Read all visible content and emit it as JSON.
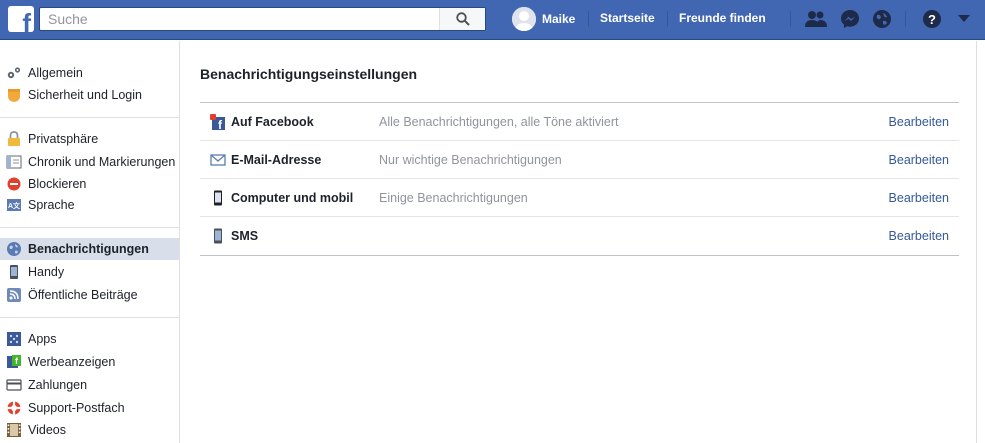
{
  "topbar": {
    "search_placeholder": "Suche",
    "user_name": "Maike",
    "home_label": "Startseite",
    "find_friends_label": "Freunde finden",
    "icons": [
      "friend-requests-icon",
      "messenger-icon",
      "notifications-globe-icon",
      "help-icon",
      "menu-arrow-icon"
    ]
  },
  "sidebar": {
    "items": [
      {
        "label": "Allgemein",
        "icon": "gears-icon"
      },
      {
        "label": "Sicherheit und Login",
        "icon": "shield-icon"
      },
      {
        "label": "Privatsphäre",
        "icon": "lock-icon"
      },
      {
        "label": "Chronik und Markierungen",
        "icon": "timeline-icon"
      },
      {
        "label": "Blockieren",
        "icon": "block-icon"
      },
      {
        "label": "Sprache",
        "icon": "language-icon"
      },
      {
        "label": "Benachrichtigungen",
        "icon": "globe-icon",
        "active": true
      },
      {
        "label": "Handy",
        "icon": "phone-icon"
      },
      {
        "label": "Öffentliche Beiträge",
        "icon": "rss-icon"
      },
      {
        "label": "Apps",
        "icon": "apps-icon"
      },
      {
        "label": "Werbeanzeigen",
        "icon": "ads-icon"
      },
      {
        "label": "Zahlungen",
        "icon": "card-icon"
      },
      {
        "label": "Support-Postfach",
        "icon": "lifebuoy-icon"
      },
      {
        "label": "Videos",
        "icon": "film-icon"
      }
    ]
  },
  "main": {
    "title": "Benachrichtigungseinstellungen",
    "rows": [
      {
        "name": "Auf Facebook",
        "description": "Alle Benachrichtigungen, alle Töne aktiviert",
        "action": "Bearbeiten",
        "icon": "facebook-notification-icon"
      },
      {
        "name": "E-Mail-Adresse",
        "description": "Nur wichtige Benachrichtigungen",
        "action": "Bearbeiten",
        "icon": "envelope-icon"
      },
      {
        "name": "Computer und mobil",
        "description": "Einige Benachrichtigungen",
        "action": "Bearbeiten",
        "icon": "mobile-device-icon"
      },
      {
        "name": "SMS",
        "description": "",
        "action": "Bearbeiten",
        "icon": "sms-phone-icon"
      }
    ]
  },
  "colors": {
    "brand_blue": "#4267b2",
    "link_blue": "#365899",
    "active_bg": "#d8dfea"
  }
}
